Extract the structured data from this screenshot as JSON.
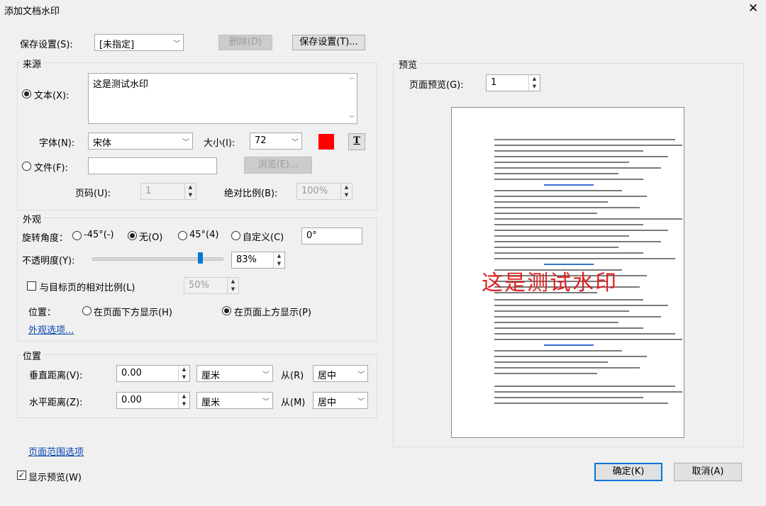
{
  "window": {
    "title": "添加文档水印"
  },
  "settings": {
    "label": "保存设置(S):",
    "value": "[未指定]",
    "delete_label": "删除(D)",
    "save_label": "保存设置(T)..."
  },
  "source": {
    "group_title": "来源",
    "text_label": "文本(X):",
    "text_value": "这是测试水印",
    "font_label": "字体(N):",
    "font_value": "宋体",
    "size_label": "大小(I):",
    "size_value": "72",
    "color": "#ff0000",
    "file_label": "文件(F):",
    "file_value": "",
    "browse_label": "浏览(E)...",
    "page_label": "页码(U):",
    "page_value": "1",
    "scale_label": "绝对比例(B):",
    "scale_value": "100%"
  },
  "appearance": {
    "group_title": "外观",
    "rotation_label": "旋转角度：",
    "rot_neg45": "-45°(-)",
    "rot_none": "无(O)",
    "rot_45": "45°(4)",
    "rot_custom": "自定义(C)",
    "rot_custom_value": "0°",
    "opacity_label": "不透明度(Y):",
    "opacity_value": "83%",
    "opacity_level": 0.83,
    "relative_scale_label": "与目标页的相对比例(L)",
    "relative_scale_value": "50%",
    "position_label": "位置：",
    "pos_below": "在页面下方显示(H)",
    "pos_above": "在页面上方显示(P)",
    "options_link": "外观选项..."
  },
  "position": {
    "group_title": "位置",
    "vertical_label": "垂直距离(V):",
    "vertical_value": "0.00",
    "vertical_unit": "厘米",
    "from_v_label": "从(R)",
    "from_v_value": "居中",
    "horizontal_label": "水平距离(Z):",
    "horizontal_value": "0.00",
    "horizontal_unit": "厘米",
    "from_h_label": "从(M)",
    "from_h_value": "居中"
  },
  "preview": {
    "group_title": "预览",
    "page_label": "页面预览(G):",
    "page_value": "1",
    "watermark_text": "这是测试水印"
  },
  "footer": {
    "range_link": "页面范围选项",
    "show_preview_label": "显示预览(W)",
    "ok_label": "确定(K)",
    "cancel_label": "取消(A)"
  }
}
